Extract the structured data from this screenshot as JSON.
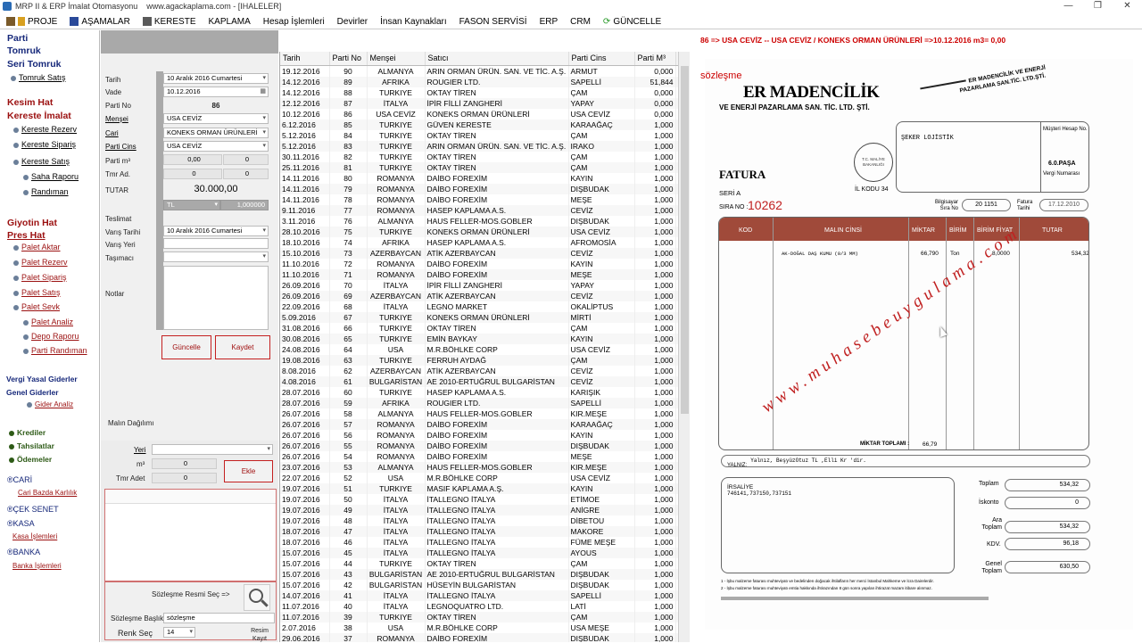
{
  "window": {
    "title": "MRP II & ERP İmalat Otomasyonu",
    "url": "www.agackaplama.com - [IHALELER]",
    "min": "—",
    "max": "❐",
    "close": "✕"
  },
  "menu": [
    "PROJE",
    "AŞAMALAR",
    "KERESTE",
    "KAPLAMA",
    "Hesap İşlemleri",
    "Devirler",
    "İnsan Kaynakları",
    "FASON SERVİSİ",
    "ERP",
    "CRM",
    "GÜNCELLE"
  ],
  "sidebar": {
    "parti": "Parti",
    "tomruk": "Tomruk",
    "seri_tomruk": "Seri Tomruk",
    "tomruk_satis": "Tomruk Satış",
    "kesim_hat": "Kesim Hat",
    "kereste_imalat": "Kereste İmalat",
    "kereste_rezerv": "Kereste Rezerv",
    "kereste_siparis": "Kereste Sipariş",
    "kereste_satis": "Kereste Satış",
    "saha_raporu": "Saha Raporu",
    "randiman": "Randıman",
    "giyotin_hat": "Giyotin Hat",
    "pres_hat": "Pres Hat",
    "palet_aktar": "Palet Aktar",
    "palet_rezerv": "Palet Rezerv",
    "palet_siparis": "Palet Sipariş",
    "palet_satis": "Palet Satış",
    "palet_sevk": "Palet Sevk",
    "palet_analiz": "Palet  Analiz",
    "depo_raporu": "Depo Raporu",
    "parti_randiman": "Parti Randıman",
    "vergi": "Vergi Yasal Giderler",
    "genel": "Genel Giderler",
    "gider_analiz": "Gider Analiz",
    "krediler": "Krediler",
    "tahsilatlar": "Tahsilatlar",
    "odemeler": "Ödemeler",
    "cari": "CARİ",
    "cari_bazda": "Cari Bazda Karlılık",
    "cek_senet": "ÇEK  SENET",
    "kasa": "KASA",
    "kasa_islemleri": "Kasa İşlemleri",
    "banka": "BANKA",
    "banka_islemleri": "Banka İşlemleri"
  },
  "form": {
    "tarih_label": "Tarih",
    "tarih": "10  Aralık   2016 Cumartesi",
    "vade_label": "Vade",
    "vade": "10.12.2016",
    "parti_no_label": "Parti No",
    "parti_no": "86",
    "mensei_label": "Menşei",
    "mensei": "USA CEVİZ",
    "cari_label": "Cari",
    "cari": "KONEKS ORMAN ÜRÜNLERİ",
    "parti_cins_label": "Parti Cins",
    "parti_cins": "USA CEVİZ",
    "parti_m3_label": "Parti m³",
    "parti_m3": "0,00",
    "parti_m3b": "0",
    "tmr_ad_label": "Tmr Ad.",
    "tmr_ad": "0",
    "tmr_adb": "0",
    "tutar_label": "TUTAR",
    "tutar": "30.000,00",
    "currency": "TL",
    "rate": "1,000000",
    "teslimat_label": "Teslimat",
    "varis_tarihi_label": "Varış Tarihi",
    "varis_tarihi": "10  Aralık   2016 Cumartesi",
    "varis_yeri_label": "Varış Yeri",
    "tasimaci_label": "Taşımacı",
    "notlar_label": "Notlar",
    "guncelle": "Güncelle",
    "kaydet": "Kaydet",
    "malin_dagilimi": "Malın Dağılımı",
    "yeri_label": "Yeri",
    "m3_label": "m³",
    "m3": "0",
    "tmr_adet_label": "Tmr Adet",
    "tmr_adet": "0",
    "ekle": "Ekle",
    "sozlesme_sec": "Sözleşme  Resmi Seç =>",
    "sozlesme_baslik_label": "Sözleşme  Başlık",
    "sozlesme_baslik": "sözleşme",
    "renk_sec": "Renk Seç",
    "renk": "14",
    "resim_kayit": "Resim Kayıt"
  },
  "grid": {
    "headers": [
      "Tarih",
      "Parti No",
      "Menşei",
      "Satıcı",
      "Parti Cins",
      "Parti M³",
      "T"
    ],
    "rows": [
      [
        "19.12.2016",
        "90",
        "ALMANYA",
        "ARIN ORMAN ÜRÜN. SAN. VE TİC. A.Ş.",
        "ARMUT",
        "0,000"
      ],
      [
        "14.12.2016",
        "89",
        "AFRIKA",
        "ROUGIER LTD.",
        "SAPELLİ",
        "51,844"
      ],
      [
        "14.12.2016",
        "88",
        "TURKIYE",
        "OKTAY TİREN",
        "ÇAM",
        "0,000"
      ],
      [
        "12.12.2016",
        "87",
        "İTALYA",
        "İPİR FİLLİ ZANGHERİ",
        "YAPAY",
        "0,000"
      ],
      [
        "10.12.2016",
        "86",
        "USA CEVİZ",
        "KONEKS ORMAN ÜRÜNLERİ",
        "USA CEVİZ",
        "0,000"
      ],
      [
        "6.12.2016",
        "85",
        "TURKIYE",
        "GÜVEN KERESTE",
        "KARAAĞAÇ",
        "1,000"
      ],
      [
        "5.12.2016",
        "84",
        "TURKIYE",
        "OKTAY TİREN",
        "ÇAM",
        "1,000"
      ],
      [
        "5.12.2016",
        "83",
        "TURKIYE",
        "ARIN ORMAN ÜRÜN. SAN. VE TİC. A.Ş.",
        "IRAKO",
        "1,000"
      ],
      [
        "30.11.2016",
        "82",
        "TURKIYE",
        "OKTAY TİREN",
        "ÇAM",
        "1,000"
      ],
      [
        "25.11.2016",
        "81",
        "TURKIYE",
        "OKTAY TİREN",
        "ÇAM",
        "1,000"
      ],
      [
        "14.11.2016",
        "80",
        "ROMANYA",
        "DAİBO FOREXİM",
        "KAYIN",
        "1,000"
      ],
      [
        "14.11.2016",
        "79",
        "ROMANYA",
        "DAİBO FOREXİM",
        "DIŞBUDAK",
        "1,000"
      ],
      [
        "14.11.2016",
        "78",
        "ROMANYA",
        "DAİBO FOREXİM",
        "MEŞE",
        "1,000"
      ],
      [
        "9.11.2016",
        "77",
        "ROMANYA",
        "HASEP KAPLAMA A.S.",
        "CEVİZ",
        "1,000"
      ],
      [
        "3.11.2016",
        "76",
        "ALMANYA",
        "HAUS FELLER-MOS.GOBLER",
        "DIŞBUDAK",
        "1,000"
      ],
      [
        "28.10.2016",
        "75",
        "TURKIYE",
        "KONEKS ORMAN ÜRÜNLERİ",
        "USA CEVİZ",
        "1,000"
      ],
      [
        "18.10.2016",
        "74",
        "AFRIKA",
        "HASEP KAPLAMA A.S.",
        "AFROMOSİA",
        "1,000"
      ],
      [
        "15.10.2016",
        "73",
        "AZERBAYCAN",
        "ATİK AZERBAYCAN",
        "CEVİZ",
        "1,000"
      ],
      [
        "11.10.2016",
        "72",
        "ROMANYA",
        "DAİBO FOREXİM",
        "KAYIN",
        "1,000"
      ],
      [
        "11.10.2016",
        "71",
        "ROMANYA",
        "DAİBO FOREXİM",
        "MEŞE",
        "1,000"
      ],
      [
        "26.09.2016",
        "70",
        "İTALYA",
        "İPİR FİLLİ ZANGHERİ",
        "YAPAY",
        "1,000"
      ],
      [
        "26.09.2016",
        "69",
        "AZERBAYCAN",
        "ATİK AZERBAYCAN",
        "CEVİZ",
        "1,000"
      ],
      [
        "22.09.2016",
        "68",
        "İTALYA",
        "LEGNO MARKET",
        "OKALİPTUS",
        "1,000"
      ],
      [
        "5.09.2016",
        "67",
        "TURKIYE",
        "KONEKS ORMAN ÜRÜNLERİ",
        "MİRTİ",
        "1,000"
      ],
      [
        "31.08.2016",
        "66",
        "TURKIYE",
        "OKTAY TİREN",
        "ÇAM",
        "1,000"
      ],
      [
        "30.08.2016",
        "65",
        "TURKIYE",
        "EMİN BAYKAY",
        "KAYIN",
        "1,000"
      ],
      [
        "24.08.2016",
        "64",
        "USA",
        "M.R.BÖHLKE CORP",
        "USA CEVİZ",
        "1,000"
      ],
      [
        "19.08.2016",
        "63",
        "TURKIYE",
        "FERRUH AYDAĞ",
        "ÇAM",
        "1,000"
      ],
      [
        "8.08.2016",
        "62",
        "AZERBAYCAN",
        "ATİK AZERBAYCAN",
        "CEVİZ",
        "1,000"
      ],
      [
        "4.08.2016",
        "61",
        "BULGARİSTAN",
        "AE 2010-ERTUĞRUL BULGARİSTAN",
        "CEVİZ",
        "1,000"
      ],
      [
        "28.07.2016",
        "60",
        "TURKIYE",
        "HASEP KAPLAMA A.S.",
        "KARIŞIK",
        "1,000"
      ],
      [
        "28.07.2016",
        "59",
        "AFRIKA",
        "ROUGIER LTD.",
        "SAPELLİ",
        "1,000"
      ],
      [
        "26.07.2016",
        "58",
        "ALMANYA",
        "HAUS FELLER-MOS.GOBLER",
        "KIR.MEŞE",
        "1,000"
      ],
      [
        "26.07.2016",
        "57",
        "ROMANYA",
        "DAİBO FOREXİM",
        "KARAAĞAÇ",
        "1,000"
      ],
      [
        "26.07.2016",
        "56",
        "ROMANYA",
        "DAİBO FOREXİM",
        "KAYIN",
        "1,000"
      ],
      [
        "26.07.2016",
        "55",
        "ROMANYA",
        "DAİBO FOREXİM",
        "DIŞBUDAK",
        "1,000"
      ],
      [
        "26.07.2016",
        "54",
        "ROMANYA",
        "DAİBO FOREXİM",
        "MEŞE",
        "1,000"
      ],
      [
        "23.07.2016",
        "53",
        "ALMANYA",
        "HAUS FELLER-MOS.GOBLER",
        "KIR.MEŞE",
        "1,000"
      ],
      [
        "22.07.2016",
        "52",
        "USA",
        "M.R.BÖHLKE CORP",
        "USA CEVİZ",
        "1,000"
      ],
      [
        "19.07.2016",
        "51",
        "TURKIYE",
        "MASIF KAPLAMA A.Ş.",
        "KAYIN",
        "1,000"
      ],
      [
        "19.07.2016",
        "50",
        "İTALYA",
        "İTALLEGNO İTALYA",
        "ETİMOE",
        "1,000"
      ],
      [
        "19.07.2016",
        "49",
        "İTALYA",
        "İTALLEGNO İTALYA",
        "ANİGRE",
        "1,000"
      ],
      [
        "19.07.2016",
        "48",
        "İTALYA",
        "İTALLEGNO İTALYA",
        "DİBETOU",
        "1,000"
      ],
      [
        "18.07.2016",
        "47",
        "İTALYA",
        "İTALLEGNO İTALYA",
        "MAKORE",
        "1,000"
      ],
      [
        "18.07.2016",
        "46",
        "İTALYA",
        "İTALLEGNO İTALYA",
        "FÜME MEŞE",
        "1,000"
      ],
      [
        "15.07.2016",
        "45",
        "İTALYA",
        "İTALLEGNO İTALYA",
        "AYOUS",
        "1,000"
      ],
      [
        "15.07.2016",
        "44",
        "TURKIYE",
        "OKTAY TİREN",
        "ÇAM",
        "1,000"
      ],
      [
        "15.07.2016",
        "43",
        "BULGARİSTAN",
        "AE 2010-ERTUĞRUL BULGARİSTAN",
        "DIŞBUDAK",
        "1,000"
      ],
      [
        "15.07.2016",
        "42",
        "BULGARİSTAN",
        "HÜSEYİN BULGARİSTAN",
        "DIŞBUDAK",
        "1,000"
      ],
      [
        "14.07.2016",
        "41",
        "İTALYA",
        "İTALLEGNO İTALYA",
        "SAPELLİ",
        "1,000"
      ],
      [
        "11.07.2016",
        "40",
        "İTALYA",
        "LEGNOQUATRO LTD.",
        "LATİ",
        "1,000"
      ],
      [
        "11.07.2016",
        "39",
        "TURKIYE",
        "OKTAY TİREN",
        "ÇAM",
        "1,000"
      ],
      [
        "2.07.2016",
        "38",
        "USA",
        "M.R.BÖHLKE CORP",
        "USA MEŞE",
        "1,000"
      ],
      [
        "29.06.2016",
        "37",
        "ROMANYA",
        "DAİBO FOREXİM",
        "DIŞBUDAK",
        "1,000"
      ]
    ]
  },
  "path": "86 => USA CEVİZ -- USA CEVİZ / KONEKS ORMAN ÜRÜNLERİ =>10.12.2016  m3= 0,00",
  "doc": {
    "label": "sözleşme",
    "company": "ER MADENCİLİK",
    "company_sub": "VE ENERJİ PAZARLAMA SAN. TİC. LTD. ŞTİ.",
    "logo_text1": "ER MADENCİLİK VE ENERJİ",
    "logo_text2": "PAZARLAMA SAN.TİC. LTD.ŞTİ.",
    "fatura": "FATURA",
    "seri": "SERİ A",
    "sira_no_label": "SIRA NO :",
    "sira_no": "10262",
    "il_kodu": "İL KODU 34",
    "musteri": "ŞEKER LOJİSTİK",
    "musteri_hesap": "Müşteri Hesap No.",
    "vergi_no": "Vergi Numarası",
    "vergi_dairesi": "6.0.PAŞA",
    "bilgisayar": "Bilgisayar Sıra No",
    "bilgisayar_no": "20    1151",
    "fatura_tarihi_label": "Fatura Tarihi",
    "fatura_tarihi": "17.12.2010",
    "stamp": "T.C. MALİYE BAKANLIĞI",
    "cols": [
      "KOD",
      "MALIN CİNSİ",
      "MİKTAR",
      "BİRİM",
      "BİRİM FİYAT",
      "TUTAR"
    ],
    "item": {
      "desc": "AK-DOĞAL DAŞ KUMU (0/3 MM)",
      "qty": "66,790",
      "unit": "Ton",
      "price": "8,0000",
      "total": "534,32"
    },
    "miktar_toplami": "MİKTAR TOPLAMI :",
    "miktar_toplami_val": "66,79",
    "yalniz": "YALNIZ:",
    "yalniz_text": "Yalnız, BeşyüzOtuz TL  ,Elli Kr  'dir.",
    "irsaliye": "İRSALİYE",
    "irsaliye_no": "746141,737150,737151",
    "toplam": "Toplam",
    "toplam_val": "534,32",
    "iskonto": "İskonto",
    "iskonto_val": "0",
    "ara_toplam": "Ara Toplam",
    "ara_toplam_val": "534,32",
    "kdv": "KDV.",
    "kdv_val": "96,18",
    "genel_toplam": "Genel Toplam",
    "genel_toplam_val": "630,50",
    "note1": "1 - İşbu malzeme faturası muhteviyatı ve bedelinden doğacak ihtilafların her merci İstanbul Mahkeme ve İcra Dairelerdir.",
    "note2": "2 - İşbu malzeme faturası muhteviyatı emtia hakkında ihtirazından 8 gün sonra yapılan ihtirazat mazam itibare alınmaz.",
    "watermark": "www.muhasebeuygulama.com"
  }
}
